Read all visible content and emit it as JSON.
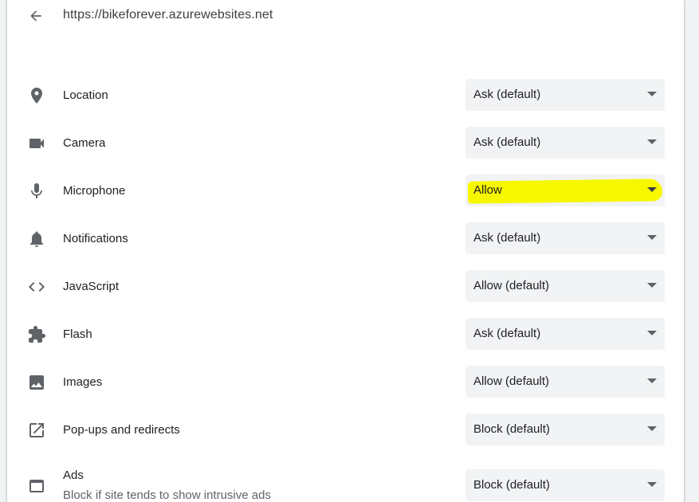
{
  "header": {
    "url": "https://bikeforever.azurewebsites.net",
    "back_icon": "arrow-back-icon"
  },
  "permissions": [
    {
      "id": "location",
      "label": "Location",
      "value": "Ask (default)",
      "icon": "location-pin-icon"
    },
    {
      "id": "camera",
      "label": "Camera",
      "value": "Ask (default)",
      "icon": "videocam-icon"
    },
    {
      "id": "microphone",
      "label": "Microphone",
      "value": "Allow",
      "icon": "microphone-icon",
      "highlight_color": "#f7f700"
    },
    {
      "id": "notifications",
      "label": "Notifications",
      "value": "Ask (default)",
      "icon": "bell-icon"
    },
    {
      "id": "javascript",
      "label": "JavaScript",
      "value": "Allow (default)",
      "icon": "code-icon"
    },
    {
      "id": "flash",
      "label": "Flash",
      "value": "Ask (default)",
      "icon": "puzzle-piece-icon"
    },
    {
      "id": "images",
      "label": "Images",
      "value": "Allow (default)",
      "icon": "image-icon"
    },
    {
      "id": "popups",
      "label": "Pop-ups and redirects",
      "value": "Block (default)",
      "icon": "open-in-new-icon"
    },
    {
      "id": "ads",
      "label": "Ads",
      "sublabel": "Block if site tends to show intrusive ads",
      "value": "Block (default)",
      "icon": "web-asset-icon"
    }
  ],
  "colors": {
    "icon": "#5f6368",
    "select_bg": "#f1f3f4",
    "highlight": "#f7f700"
  }
}
